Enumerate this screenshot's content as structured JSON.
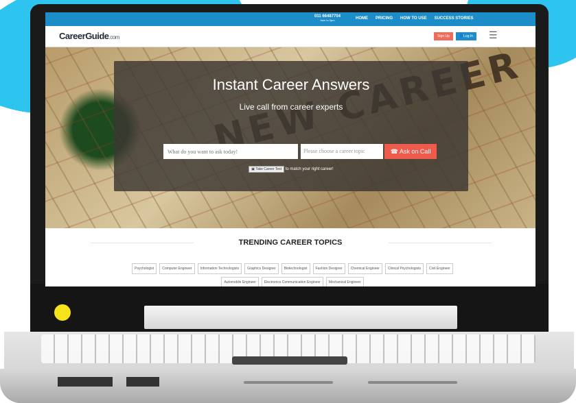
{
  "topbar": {
    "phone": "011 66487704",
    "hours": "9am to 9pm",
    "nav": [
      "HOME",
      "PRICING",
      "HOW TO USE",
      "SUCCESS STORIES"
    ]
  },
  "header": {
    "logo_main": "CareerGuide",
    "logo_suffix": ".com",
    "signup_label": "Sign Up",
    "login_label": "Log In"
  },
  "hero": {
    "title": "Instant Career Answers",
    "subtitle": "Live call from career experts",
    "background_text": "NEW CAREER",
    "ask_placeholder": "What do you want to ask today!",
    "topic_placeholder": "Please choose a career topic",
    "ask_button_label": "Ask on Call",
    "test_button_label": "Take Career Test",
    "test_suffix": "to match your right career!"
  },
  "trending": {
    "title": "TRENDING CAREER TOPICS",
    "tags": [
      "Psychologist",
      "Computer Engineer",
      "Information Technologists",
      "Graphics Designer",
      "Biotechnologist",
      "Fashion Designer",
      "Chemical Engineer",
      "Clinical Psychologists",
      "Civil Engineer",
      "Automobile Engineer",
      "Electronics Communication Engineer",
      "Mechanical Engineer"
    ]
  },
  "colors": {
    "accent_blue": "#1d8dc9",
    "accent_red": "#ef5b4a",
    "background_wave": "#2ec4f0"
  }
}
